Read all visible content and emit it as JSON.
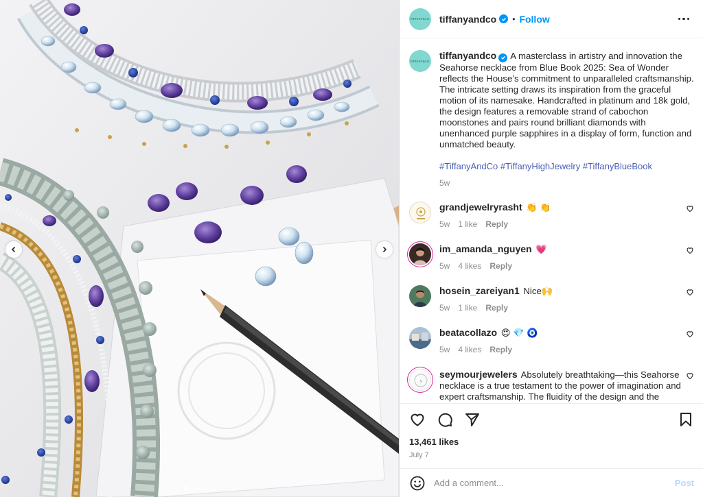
{
  "post": {
    "author": "tiffanyandco",
    "author_avatar_text": "TIFFANY&CO.",
    "separator": "•",
    "follow_label": "Follow",
    "caption": "A masterclass in artistry and innovation the Seahorse necklace from Blue Book 2025: Sea of Wonder reflects the House’s commitment to unparalleled craftsmanship. The intricate setting draws its inspiration from the graceful motion of its namesake. Handcrafted in platinum and 18k gold, the design features a removable strand of cabochon moonstones and pairs round brilliant diamonds with unenhanced purple sapphires in a display of form, function and unmatched beauty.",
    "hashtags": "#TiffanyAndCo #TiffanyHighJewelry #TiffanyBlueBook",
    "caption_time": "5w"
  },
  "comments": [
    {
      "user": "grandjewelryrasht",
      "text": "👏 👏",
      "time": "5w",
      "likes": "1 like",
      "reply": "Reply"
    },
    {
      "user": "im_amanda_nguyen",
      "text": "💗",
      "time": "5w",
      "likes": "4 likes",
      "reply": "Reply"
    },
    {
      "user": "hosein_zareiyan1",
      "text": "Nice🙌",
      "time": "5w",
      "likes": "1 like",
      "reply": "Reply"
    },
    {
      "user": "beatacollazo",
      "text": "😍 💎 🧿",
      "time": "5w",
      "likes": "4 likes",
      "reply": "Reply"
    },
    {
      "user": "seymourjewelers",
      "text": "Absolutely breathtaking—this Seahorse necklace is a true testament to the power of imagination and expert craftsmanship. The fluidity of the design and the thoughtful pairing of unenhanced purple sapphires with moonstones create such an ethereal, oceanic elegance. A",
      "time": "",
      "likes": "",
      "reply": ""
    }
  ],
  "stats": {
    "likes": "13,461 likes",
    "date": "July 7"
  },
  "composer": {
    "placeholder": "Add a comment...",
    "post_label": "Post"
  },
  "colors": {
    "tiffany_blue": "#81d8d0",
    "link": "#0095f6",
    "hashtag": "#4a5fb6"
  },
  "carousel": {
    "slide_count": 5,
    "active_slide": 1
  }
}
